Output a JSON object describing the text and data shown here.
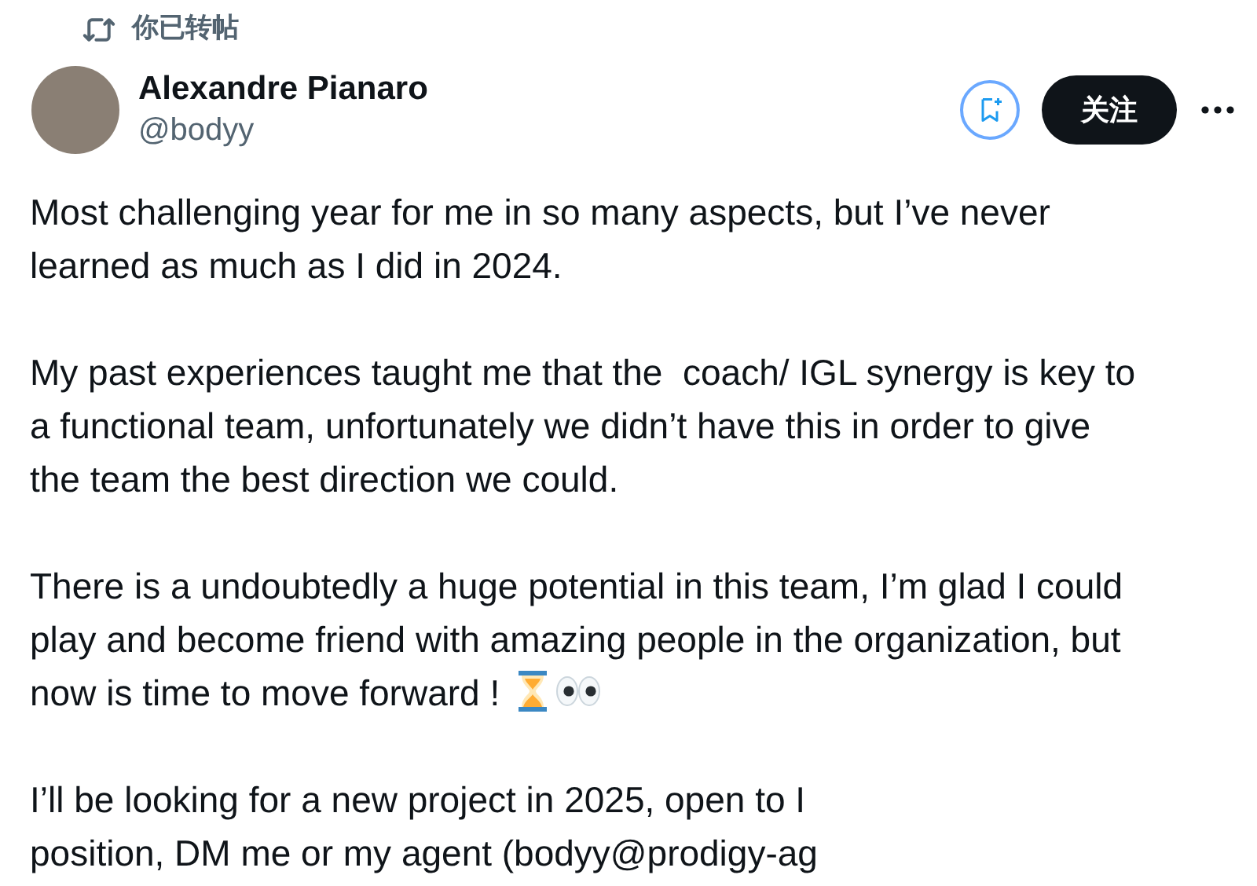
{
  "repost_banner": {
    "label": "你已转帖"
  },
  "author": {
    "name": "Alexandre Pianaro",
    "handle": "@bodyy"
  },
  "follow_button": {
    "label": "关注"
  },
  "paragraphs": [
    {
      "lines": [
        "Most challenging year for me in so many aspects, but I’ve never",
        "learned as much as I did in 2024."
      ]
    },
    {
      "lines": [
        "My past experiences taught me that the  coach/ IGL synergy is key to",
        "a functional team, unfortunately we didn’t have this in order to give",
        "the team the best direction we could."
      ]
    },
    {
      "lines": [
        "There is a undoubtedly a huge potential in this team, I’m glad I could",
        "play and become friend with amazing people in the organization, but",
        "now is time to move forward !"
      ],
      "hourglass_emoji": true,
      "eyes_emoji": true
    },
    {
      "lines": [
        "I’ll be looking for a new project in 2025, open to I",
        "position, DM me or my agent (bodyy@prodigy-ag"
      ]
    }
  ]
}
